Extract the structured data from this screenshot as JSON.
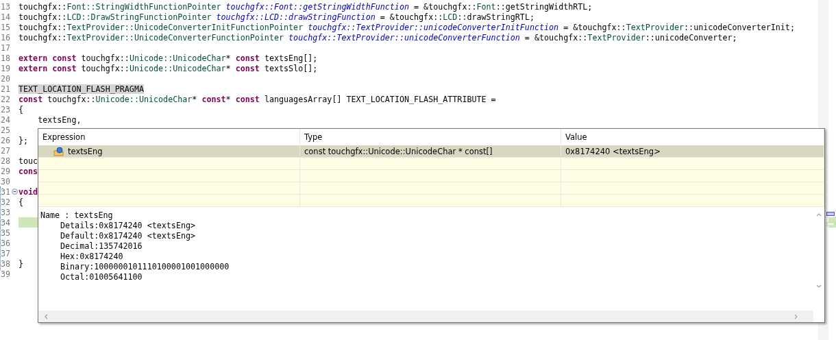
{
  "editor": {
    "lines": [
      {
        "number": "13",
        "current": false,
        "tokens": [
          {
            "text": "touchgfx::",
            "kind": "text"
          },
          {
            "text": "Font::StringWidthFunctionPointer",
            "kind": "type"
          },
          {
            "text": " touchgfx::Font::getStringWidthFunction",
            "kind": "field"
          },
          {
            "text": " = &touchgfx::",
            "kind": "text"
          },
          {
            "text": "Font",
            "kind": "type"
          },
          {
            "text": "::getStringWidthRTL;",
            "kind": "text"
          }
        ]
      },
      {
        "number": "14",
        "current": false,
        "tokens": [
          {
            "text": "touchgfx::",
            "kind": "text"
          },
          {
            "text": "LCD::DrawStringFunctionPointer",
            "kind": "type"
          },
          {
            "text": " touchgfx::LCD::drawStringFunction",
            "kind": "field"
          },
          {
            "text": " = &touchgfx::",
            "kind": "text"
          },
          {
            "text": "LCD",
            "kind": "type"
          },
          {
            "text": "::drawStringRTL;",
            "kind": "text"
          }
        ]
      },
      {
        "number": "15",
        "current": false,
        "tokens": [
          {
            "text": "touchgfx::",
            "kind": "text"
          },
          {
            "text": "TextProvider::UnicodeConverterInitFunctionPointer",
            "kind": "type"
          },
          {
            "text": " touchgfx::TextProvider::unicodeConverterInitFunction",
            "kind": "field"
          },
          {
            "text": " = &touchgfx::",
            "kind": "text"
          },
          {
            "text": "TextProvider",
            "kind": "type"
          },
          {
            "text": "::unicodeConverterInit;",
            "kind": "text"
          }
        ]
      },
      {
        "number": "16",
        "current": false,
        "tokens": [
          {
            "text": "touchgfx::",
            "kind": "text"
          },
          {
            "text": "TextProvider::UnicodeConverterFunctionPointer",
            "kind": "type"
          },
          {
            "text": " touchgfx::TextProvider::unicodeConverterFunction",
            "kind": "field"
          },
          {
            "text": " = &touchgfx::",
            "kind": "text"
          },
          {
            "text": "TextProvider",
            "kind": "type"
          },
          {
            "text": "::unicodeConverter;",
            "kind": "text"
          }
        ]
      },
      {
        "number": "17",
        "current": false
      },
      {
        "number": "18",
        "current": false,
        "tokens": [
          {
            "text": "extern",
            "kind": "keyword"
          },
          {
            "text": " const",
            "kind": "keyword"
          },
          {
            "text": " touchgfx::",
            "kind": "text"
          },
          {
            "text": "Unicode::UnicodeChar",
            "kind": "type"
          },
          {
            "text": "* ",
            "kind": "text"
          },
          {
            "text": "const",
            "kind": "keyword"
          },
          {
            "text": " textsEng[];",
            "kind": "text"
          }
        ]
      },
      {
        "number": "19",
        "current": false,
        "tokens": [
          {
            "text": "extern",
            "kind": "keyword"
          },
          {
            "text": " const",
            "kind": "keyword"
          },
          {
            "text": " touchgfx::",
            "kind": "text"
          },
          {
            "text": "Unicode::UnicodeChar",
            "kind": "type"
          },
          {
            "text": "* ",
            "kind": "text"
          },
          {
            "text": "const",
            "kind": "keyword"
          },
          {
            "text": " textsSlo[];",
            "kind": "text"
          }
        ]
      },
      {
        "number": "20",
        "current": false
      },
      {
        "number": "21",
        "current": false,
        "tokens": [
          {
            "text": "TEXT_LOCATION_FLASH_PRAGMA",
            "kind": "marked"
          }
        ]
      },
      {
        "number": "22",
        "current": false,
        "tokens": [
          {
            "text": "const",
            "kind": "keyword"
          },
          {
            "text": " touchgfx::",
            "kind": "text"
          },
          {
            "text": "Unicode::UnicodeChar",
            "kind": "type"
          },
          {
            "text": "* ",
            "kind": "text"
          },
          {
            "text": "const",
            "kind": "keyword"
          },
          {
            "text": "* ",
            "kind": "text"
          },
          {
            "text": "const",
            "kind": "keyword"
          },
          {
            "text": " languagesArray[] TEXT_LOCATION_FLASH_ATTRIBUTE =",
            "kind": "text"
          }
        ]
      },
      {
        "number": "23",
        "current": false,
        "tokens": [
          {
            "text": "{",
            "kind": "text"
          }
        ]
      },
      {
        "number": "24",
        "current": false,
        "tokens": [
          {
            "text": "    textsEng,",
            "kind": "text"
          }
        ]
      },
      {
        "number": "25",
        "current": false
      },
      {
        "number": "26",
        "current": false,
        "tokens": [
          {
            "text": "};",
            "kind": "text"
          }
        ]
      },
      {
        "number": "27",
        "current": false
      },
      {
        "number": "28",
        "current": false,
        "tokens": [
          {
            "text": "touc",
            "kind": "text"
          }
        ]
      },
      {
        "number": "29",
        "current": false,
        "tokens": [
          {
            "text": "cons",
            "kind": "keyword"
          }
        ]
      },
      {
        "number": "30",
        "current": false
      },
      {
        "number": "31",
        "current": false,
        "fold": {
          "expanded": true
        },
        "tokens": [
          {
            "text": "void",
            "kind": "keyword"
          }
        ]
      },
      {
        "number": "32",
        "current": false,
        "tokens": [
          {
            "text": "{",
            "kind": "text"
          }
        ]
      },
      {
        "number": "33",
        "current": false
      },
      {
        "number": "34",
        "current": true
      },
      {
        "number": "35",
        "current": false
      },
      {
        "number": "36",
        "current": false
      },
      {
        "number": "37",
        "current": false
      },
      {
        "number": "38",
        "current": false,
        "tokens": [
          {
            "text": "}",
            "kind": "text"
          }
        ]
      },
      {
        "number": "39",
        "current": false
      }
    ]
  },
  "hover": {
    "columns": [
      "Expression",
      "Type",
      "Value"
    ],
    "rows": [
      {
        "expression": "textsEng",
        "type": "const touchgfx::Unicode::UnicodeChar * const[]",
        "value": "0x8174240 <textsEng>",
        "selected": true
      }
    ],
    "details": {
      "title": "Name : textsEng",
      "children": [
        "Details:0x8174240 <textsEng>",
        "Default:0x8174240 <textsEng>",
        "Decimal:135742016",
        "Hex:0x8174240",
        "Binary:1000000101110100001001000000",
        "Octal:01005641100"
      ]
    }
  }
}
